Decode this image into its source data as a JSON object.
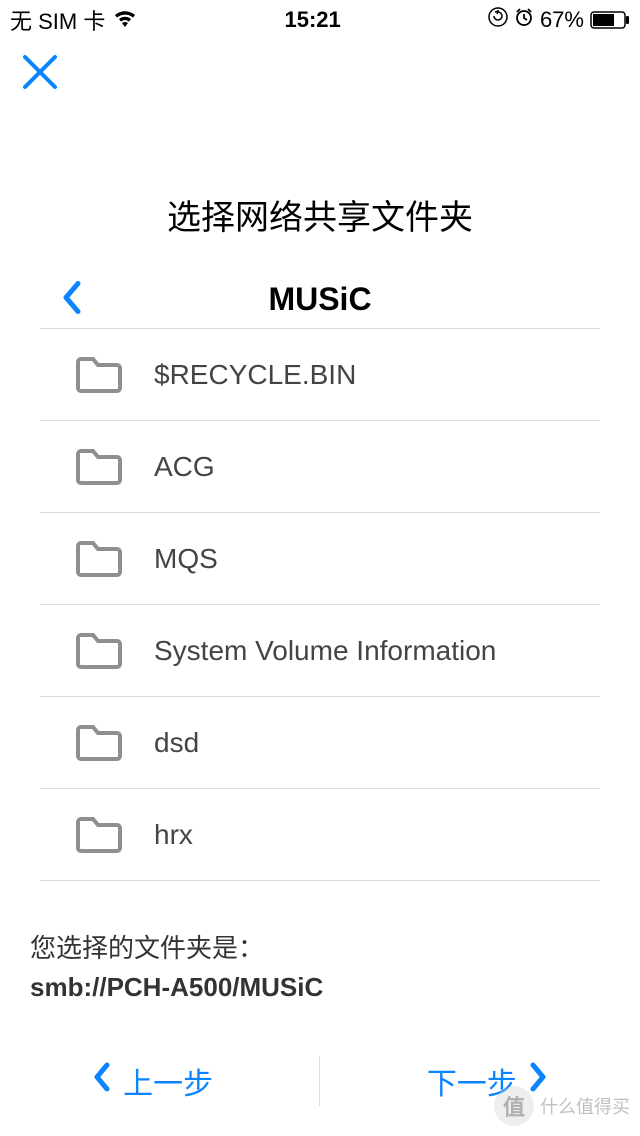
{
  "status": {
    "carrier": "无 SIM 卡",
    "time": "15:21",
    "battery": "67%"
  },
  "header": {
    "title": "选择网络共享文件夹"
  },
  "breadcrumb": {
    "current": "MUSiC"
  },
  "folders": [
    {
      "name": "$RECYCLE.BIN"
    },
    {
      "name": "ACG"
    },
    {
      "name": "MQS"
    },
    {
      "name": "System Volume Information"
    },
    {
      "name": "dsd"
    },
    {
      "name": "hrx"
    }
  ],
  "selected": {
    "label": "您选择的文件夹是：",
    "path": "smb://PCH-A500/MUSiC"
  },
  "footer": {
    "prev": "上一步",
    "next": "下一步"
  },
  "watermark": {
    "badge": "值",
    "text": "什么值得买"
  },
  "colors": {
    "accent": "#0a84ff",
    "icon_gray": "#8e8e93"
  }
}
